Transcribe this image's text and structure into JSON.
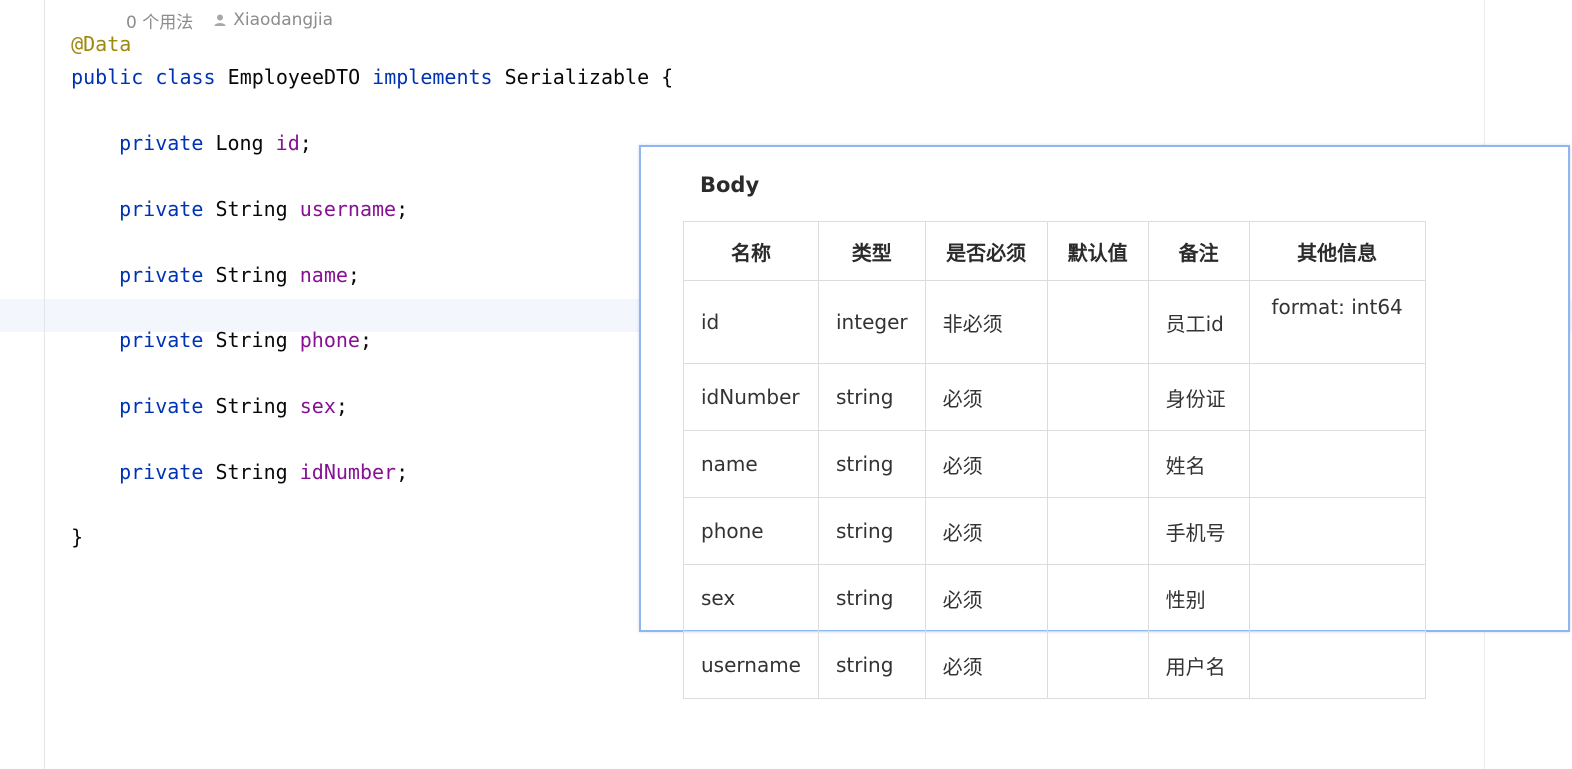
{
  "editor": {
    "inlay": {
      "usages": "0 个用法",
      "author": "Xiaodangjia"
    },
    "lines": {
      "annotation": "@Data",
      "class_kw1": "public",
      "class_kw2": "class",
      "class_name": "EmployeeDTO",
      "class_kw3": "implements",
      "class_iface": "Serializable",
      "class_brace": "{",
      "closing_brace": "}"
    },
    "fields": [
      {
        "modifier": "private",
        "type": "Long",
        "name": "id"
      },
      {
        "modifier": "private",
        "type": "String",
        "name": "username"
      },
      {
        "modifier": "private",
        "type": "String",
        "name": "name"
      },
      {
        "modifier": "private",
        "type": "String",
        "name": "phone"
      },
      {
        "modifier": "private",
        "type": "String",
        "name": "sex"
      },
      {
        "modifier": "private",
        "type": "String",
        "name": "idNumber"
      }
    ],
    "colors": {
      "keyword": "#0033b3",
      "field": "#871094",
      "annotation": "#9e880d",
      "caret_row": "#f4f6fd"
    }
  },
  "popup": {
    "title": "Body",
    "headers": [
      "名称",
      "类型",
      "是否必须",
      "默认值",
      "备注",
      "其他信息"
    ],
    "rows": [
      {
        "name": "id",
        "type": "integer",
        "required": "非必须",
        "default": "",
        "remark": "员工id",
        "extra": "format: int64"
      },
      {
        "name": "idNumber",
        "type": "string",
        "required": "必须",
        "default": "",
        "remark": "身份证",
        "extra": ""
      },
      {
        "name": "name",
        "type": "string",
        "required": "必须",
        "default": "",
        "remark": "姓名",
        "extra": ""
      },
      {
        "name": "phone",
        "type": "string",
        "required": "必须",
        "default": "",
        "remark": "手机号",
        "extra": ""
      },
      {
        "name": "sex",
        "type": "string",
        "required": "必须",
        "default": "",
        "remark": "性别",
        "extra": ""
      },
      {
        "name": "username",
        "type": "string",
        "required": "必须",
        "default": "",
        "remark": "用户名",
        "extra": ""
      }
    ],
    "border_color": "#8fb6ee"
  }
}
